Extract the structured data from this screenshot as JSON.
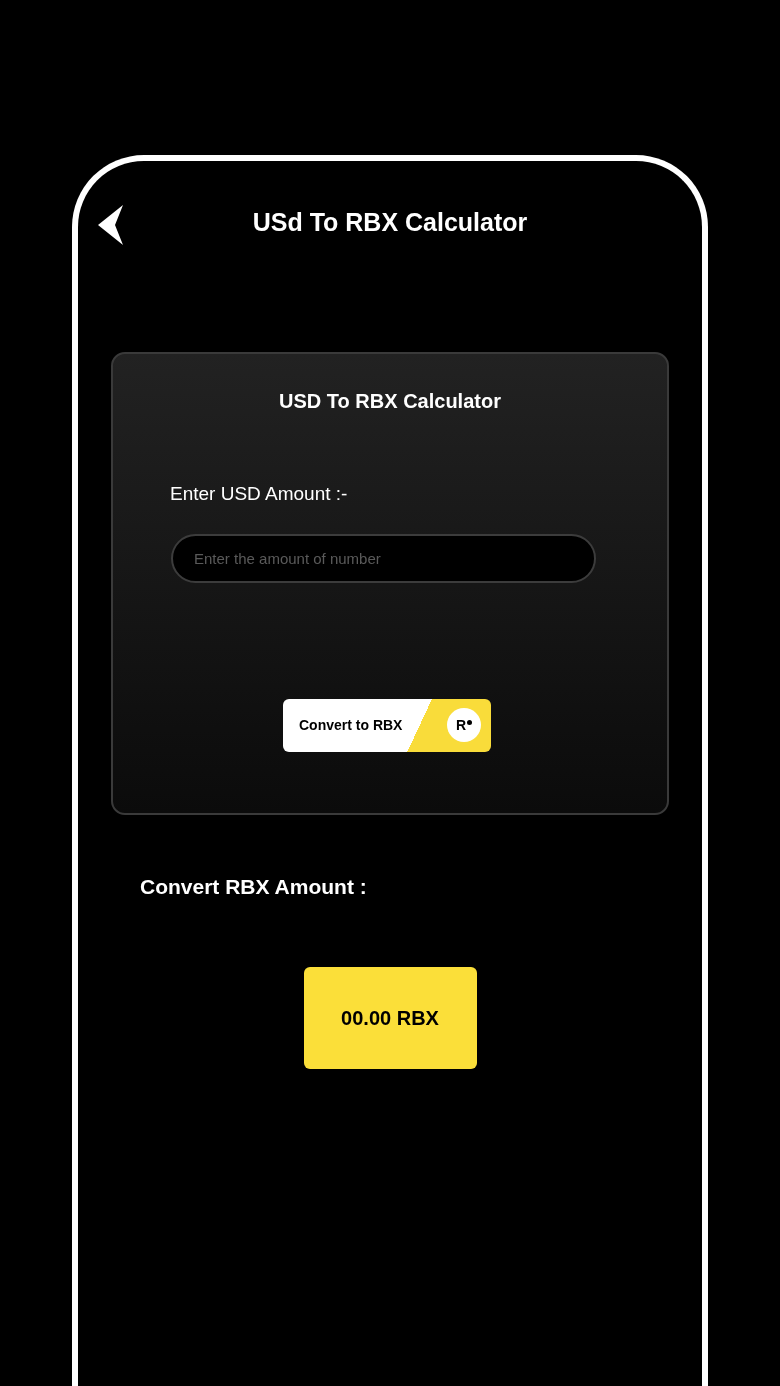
{
  "header": {
    "title": "USd To RBX Calculator"
  },
  "card": {
    "title": "USD To RBX Calculator",
    "label": "Enter USD Amount :-",
    "input": {
      "placeholder": "Enter the amount of number"
    },
    "button": {
      "label": "Convert to RBX",
      "badge": "R"
    }
  },
  "result": {
    "label": "Convert RBX Amount :",
    "value": "00.00 RBX"
  }
}
